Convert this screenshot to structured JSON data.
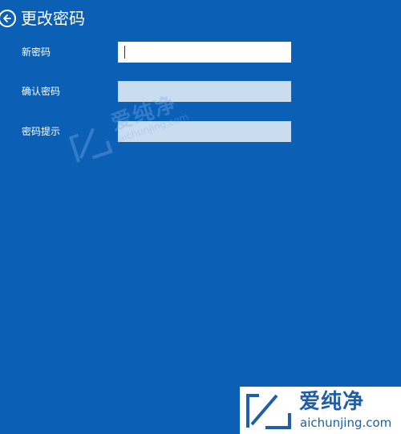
{
  "header": {
    "title": "更改密码",
    "back_icon": "back-arrow-icon"
  },
  "form": {
    "new_password": {
      "label": "新密码",
      "value": ""
    },
    "confirm_password": {
      "label": "确认密码",
      "value": ""
    },
    "password_hint": {
      "label": "密码提示",
      "value": ""
    }
  },
  "watermark": {
    "name": "爱纯净",
    "url": "aichunjing.com",
    "icon": "aichunjing-logo-icon"
  },
  "colors": {
    "background": "#0b5fb5",
    "input_active": "#ffffff",
    "input_inactive": "#c9dcf0",
    "watermark": "#1f5fa8"
  }
}
